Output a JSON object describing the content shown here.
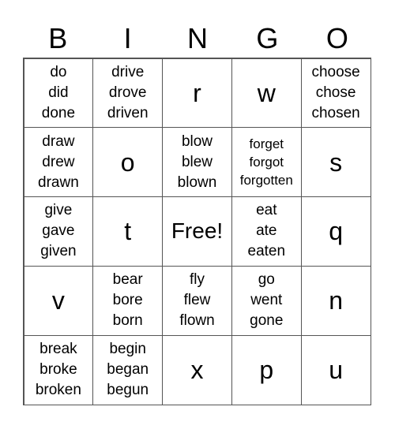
{
  "header": [
    "B",
    "I",
    "N",
    "G",
    "O"
  ],
  "cells": [
    [
      "do\ndid\ndone",
      "drive\ndrove\ndriven",
      "r",
      "w",
      "choose\nchose\nchosen"
    ],
    [
      "draw\ndrew\ndrawn",
      "o",
      "blow\nblew\nblown",
      "forget\nforgot\nforgotten",
      "s"
    ],
    [
      "give\ngave\ngiven",
      "t",
      "Free!",
      "eat\nate\neaten",
      "q"
    ],
    [
      "v",
      "bear\nbore\nborn",
      "fly\nflew\nflown",
      "go\nwent\ngone",
      "n"
    ],
    [
      "break\nbroke\nbroken",
      "begin\nbegan\nbegun",
      "x",
      "p",
      "u"
    ]
  ]
}
